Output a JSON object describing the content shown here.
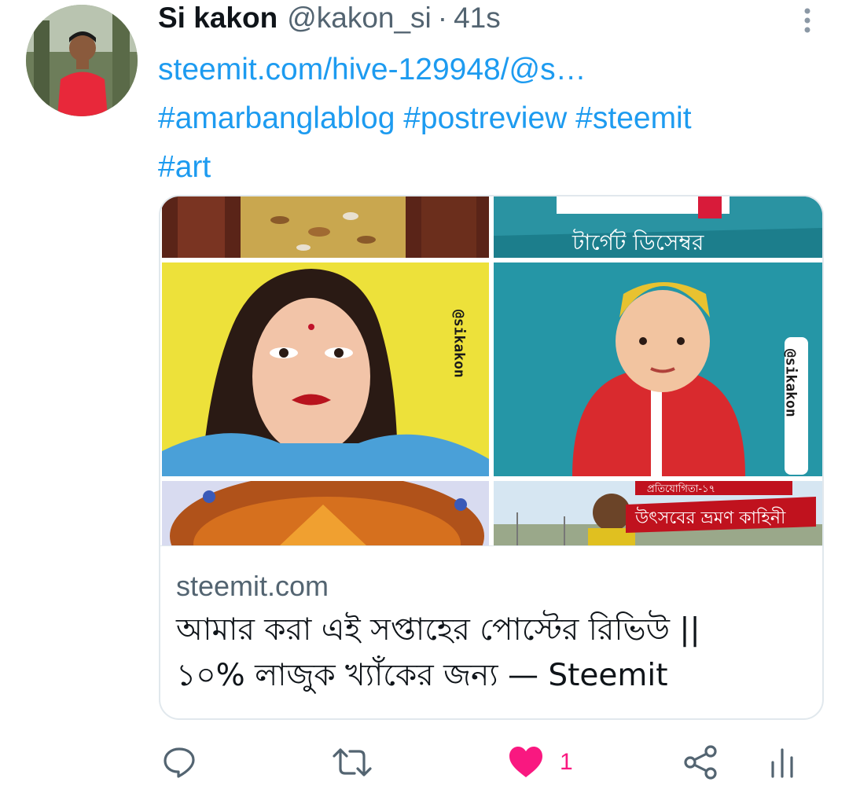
{
  "tweet": {
    "author_name": "Si kakon",
    "handle": "@kakon_si",
    "separator": "·",
    "time": "41s",
    "text_lines": [
      "steemit.com/hive-129948/@s…",
      "#amarbanglablog #postreview #steemit",
      "#art"
    ]
  },
  "card": {
    "domain": "steemit.com",
    "title_lines": [
      "আমার করা এই সপ্তাহের পোস্টের রিভিউ ||",
      "১০% লাজুক খ্যাঁকের জন্য — Steemit"
    ],
    "images": [
      {
        "name": "food-dessert-image",
        "text": ""
      },
      {
        "name": "banner-bengali-image",
        "text": "টার্গেট ডিসেম্বর"
      },
      {
        "name": "woman-portrait-art-image",
        "text": "@sikakon"
      },
      {
        "name": "baby-portrait-art-image",
        "text": "@sikakon"
      },
      {
        "name": "cake-image",
        "text": ""
      },
      {
        "name": "travel-banner-image",
        "text": "প্রতিযোগিতা-১৭",
        "text2": "উৎসবের ভ্রমণ কাহিনী"
      }
    ]
  },
  "actions": {
    "reply_icon": "reply-icon",
    "retweet_icon": "retweet-icon",
    "like_icon": "heart-filled-icon",
    "like_count": "1",
    "share_icon": "share-icon",
    "analytics_icon": "analytics-icon"
  },
  "colors": {
    "link": "#1d9bf0",
    "muted": "#536471",
    "like": "#f91880",
    "text": "#0f1419"
  }
}
